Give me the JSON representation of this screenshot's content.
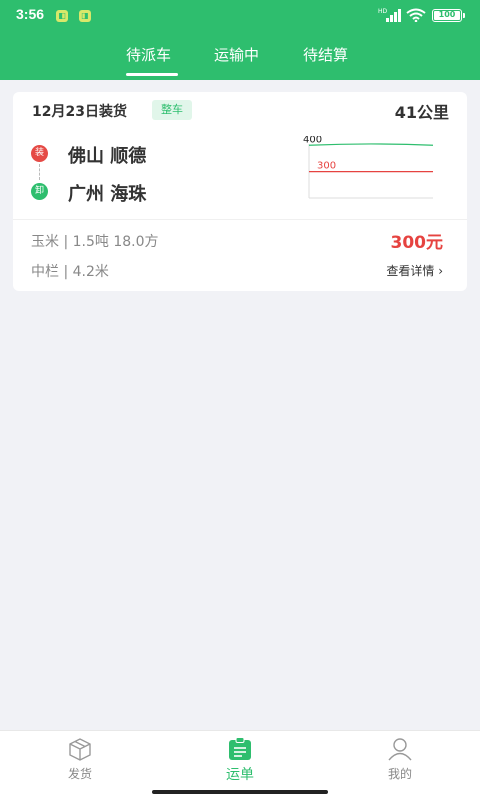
{
  "status_bar": {
    "time": "3:56",
    "signal_label": "HD",
    "battery": "100",
    "notification_icons": [
      "app-notification-icon",
      "app-notification-icon"
    ]
  },
  "tabs": [
    {
      "label": "待派车",
      "active": true
    },
    {
      "label": "运输中",
      "active": false
    },
    {
      "label": "待结算",
      "active": false
    }
  ],
  "order_card": {
    "date_label": "12月23日装货",
    "type_badge": "整车",
    "distance": "41公里",
    "load_tag": "装",
    "load_city": "佛山 顺德",
    "unload_tag": "卸",
    "unload_city": "广州 海珠",
    "goods": "玉米 | 1.5吨 18.0方",
    "price": "300元",
    "vehicle": "中栏 | 4.2米",
    "detail_link": "查看详情",
    "detail_icon": "chevron-right-icon"
  },
  "chart_data": {
    "type": "line",
    "series": [
      {
        "color": "#2ebe6e",
        "values": [
          400,
          405,
          400
        ]
      },
      {
        "color": "#e64340",
        "values": [
          300,
          300,
          300
        ]
      }
    ],
    "labels": [
      "400",
      "300"
    ],
    "ylim": [
      200,
      420
    ]
  },
  "bottom_nav": [
    {
      "label": "发货",
      "icon": "box-icon",
      "active": false
    },
    {
      "label": "运单",
      "icon": "clipboard-icon",
      "active": true
    },
    {
      "label": "我的",
      "icon": "user-icon",
      "active": false
    }
  ],
  "colors": {
    "primary": "#2ebe6e",
    "price": "#e64340",
    "load_tag": "#e54a45",
    "background": "#f1f2f6"
  }
}
